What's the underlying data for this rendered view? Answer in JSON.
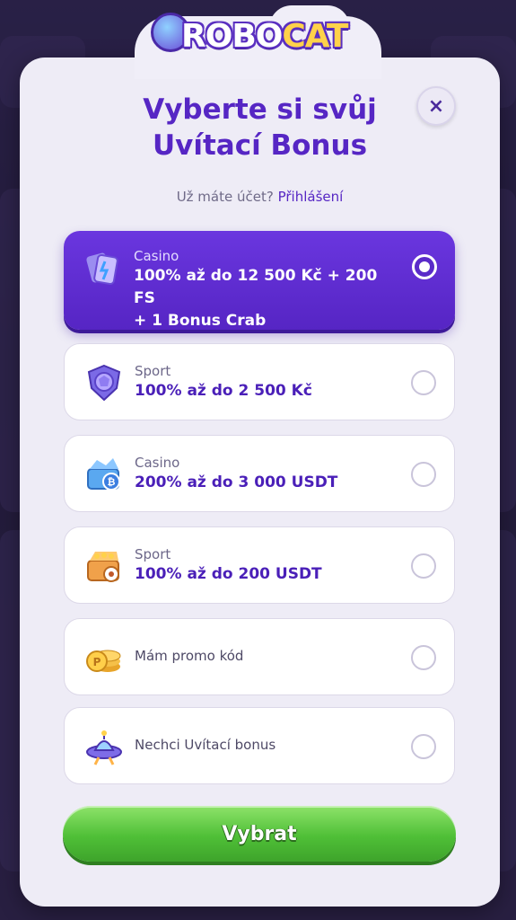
{
  "logo": {
    "part1": "ROBO",
    "part2": "CAT"
  },
  "modal": {
    "title_line1": "Vyberte si svůj",
    "title_line2": "Uvítací Bonus",
    "close_label": "×",
    "login_prompt": "Už máte účet?",
    "login_link": "Přihlášení"
  },
  "options": [
    {
      "category": "Casino",
      "bonus_line1": "100% až do 12 500 Kč + 200 FS",
      "bonus_line2": "+ 1 Bonus Crab",
      "icon": "casino-tickets-icon",
      "selected": true
    },
    {
      "category": "Sport",
      "bonus_line1": "100% až do 2 500 Kč",
      "icon": "shield-ball-icon",
      "selected": false
    },
    {
      "category": "Casino",
      "bonus_line1": "200% až do 3 000 USDT",
      "icon": "bitcoin-chest-icon",
      "selected": false
    },
    {
      "category": "Sport",
      "bonus_line1": "100% až do 200 USDT",
      "icon": "soccer-chest-icon",
      "selected": false
    },
    {
      "label": "Mám promo kód",
      "icon": "coin-stack-icon",
      "selected": false
    },
    {
      "label": "Nechci Uvítací bonus",
      "icon": "ufo-icon",
      "selected": false
    }
  ],
  "submit_label": "Vybrat",
  "colors": {
    "accent": "#5626c4",
    "cta": "#4fbf37",
    "modal_bg": "#eeecf6"
  }
}
